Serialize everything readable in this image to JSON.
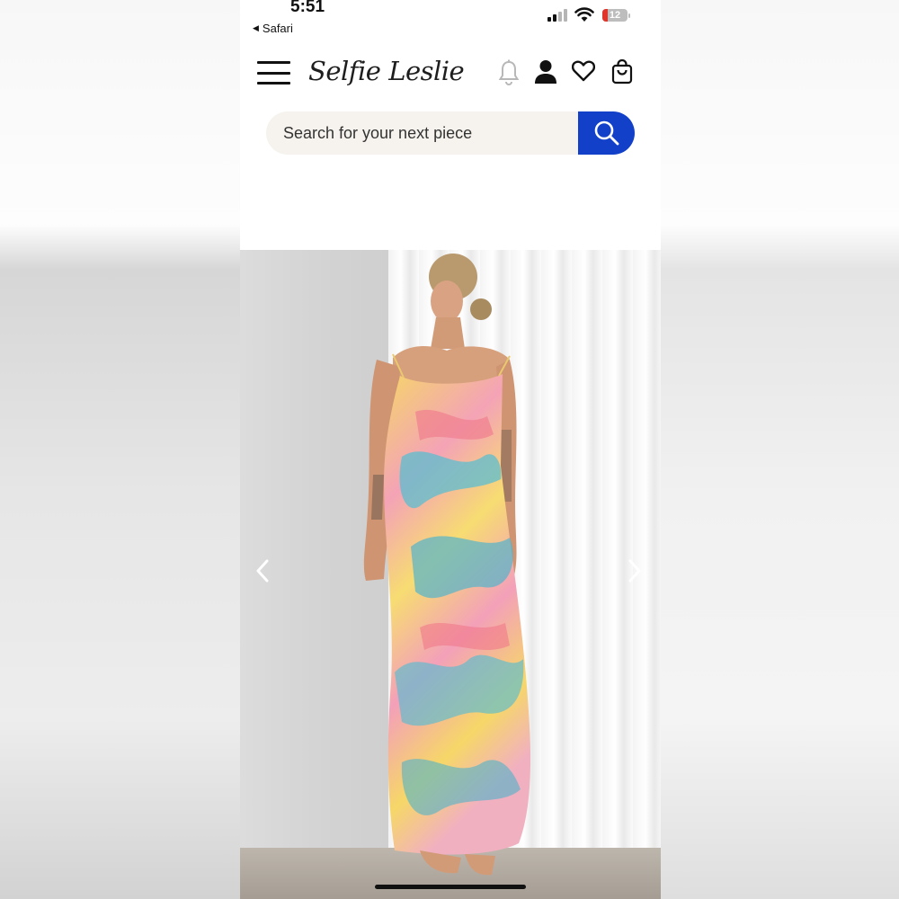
{
  "status_bar": {
    "time": "5:51",
    "back_label": "Safari",
    "battery": "12"
  },
  "header": {
    "brand": "Selfie Leslie",
    "icons": [
      "menu-icon",
      "bell-icon",
      "user-icon",
      "heart-icon",
      "bag-icon"
    ]
  },
  "search": {
    "placeholder": "Search for your next piece",
    "button_icon": "search-icon",
    "button_color": "#1240c8"
  },
  "product_gallery": {
    "image_desc_icon": "product-photo",
    "prev_icon": "chevron-left-icon",
    "next_icon": "chevron-right-icon"
  },
  "colors": {
    "brand_text": "#1e1e1e",
    "search_bg": "#f6f3ee",
    "accent_blue": "#1240c8"
  }
}
